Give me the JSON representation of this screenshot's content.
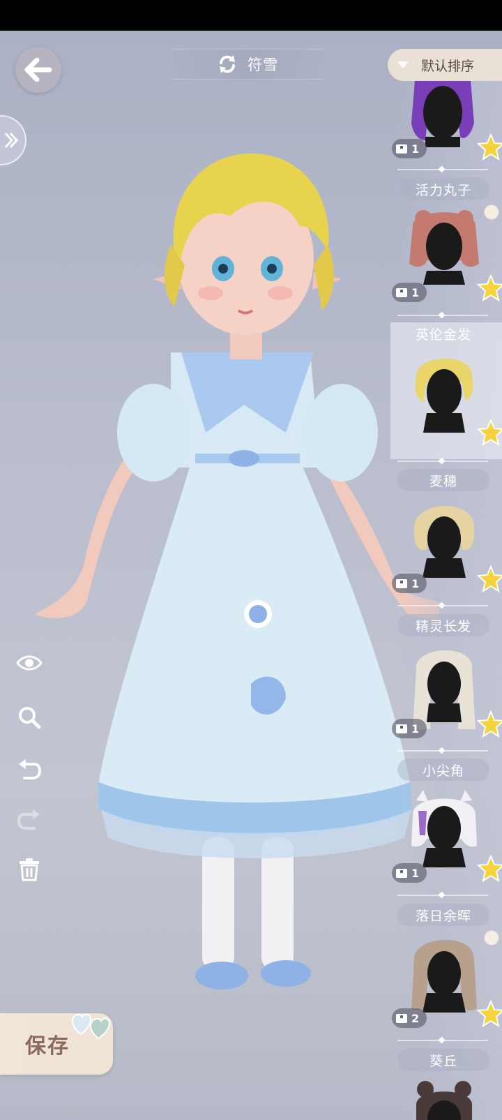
{
  "header": {
    "character_name": "符雪",
    "sort_label": "默认排序"
  },
  "save": {
    "label": "保存"
  },
  "tools": [
    "eye-icon",
    "zoom-icon",
    "undo-icon",
    "redo-icon",
    "trash-icon"
  ],
  "hair_list": [
    {
      "name": "",
      "owned": "1",
      "rarity": "star",
      "hair_color": "#7a3fb8",
      "has_palette": false
    },
    {
      "name": "活力丸子",
      "owned": "1",
      "rarity": "star",
      "hair_color": "#c57a70",
      "has_palette": true
    },
    {
      "name": "英伦金发",
      "owned": "",
      "rarity": "star",
      "hair_color": "#e9d56a",
      "has_palette": false,
      "selected": true
    },
    {
      "name": "麦穗",
      "owned": "1",
      "rarity": "star",
      "hair_color": "#e6d3a2",
      "has_palette": false
    },
    {
      "name": "精灵长发",
      "owned": "1",
      "rarity": "star",
      "hair_color": "#e8e2d6",
      "has_palette": false
    },
    {
      "name": "小尖角",
      "owned": "1",
      "rarity": "star",
      "hair_color": "#f2f0f4",
      "has_palette": false
    },
    {
      "name": "落日余晖",
      "owned": "2",
      "rarity": "star",
      "hair_color": "#b7a08c",
      "has_palette": true
    },
    {
      "name": "葵丘",
      "owned": "",
      "rarity": "star",
      "hair_color": "#4a3a3a",
      "has_palette": false
    }
  ],
  "colors": {
    "accent": "#e9e0d6",
    "star": "#f5d23a",
    "dress": "#d8ebf5",
    "dress_accent": "#8fb8e6"
  }
}
